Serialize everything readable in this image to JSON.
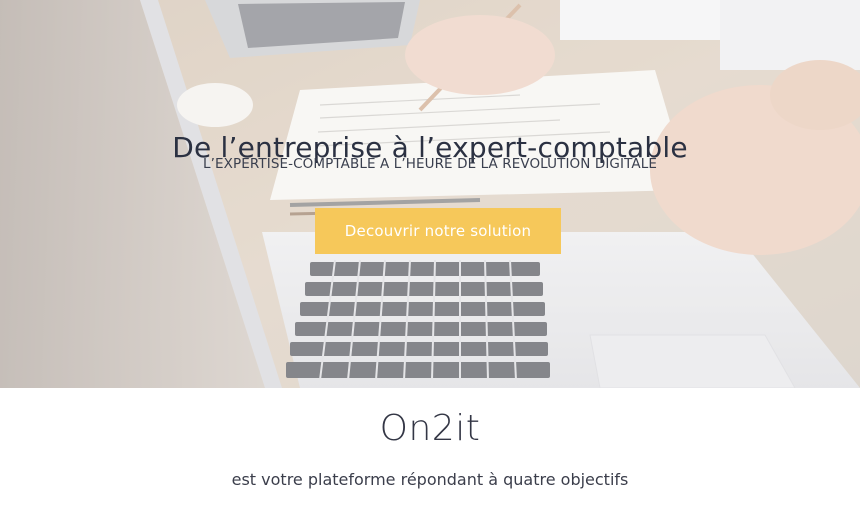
{
  "hero": {
    "title": "De l’entreprise à l’expert-comptable",
    "subtitle": "L’EXPERTISE-COMPTABLE A L’HEURE DE LA REVOLUTION DIGITALE",
    "cta_label": "Decouvrir notre solution"
  },
  "intro": {
    "brand": "On2it",
    "tagline": "est votre plateforme répondant à quatre objectifs"
  },
  "colors": {
    "cta": "#f6c85a",
    "heading_text": "#2b3142"
  }
}
